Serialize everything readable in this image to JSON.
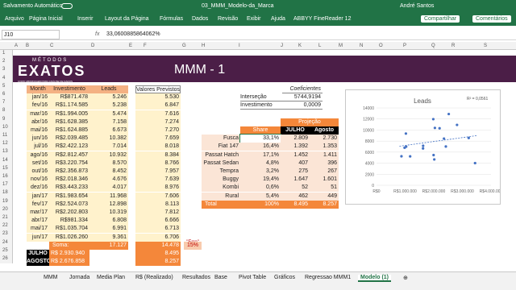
{
  "titlebar": {
    "autosave": "Salvamento Automático",
    "file": "03_MMM_Modelo-da_Marca",
    "user": "André Santos"
  },
  "ribbon": {
    "tabs": [
      "Arquivo",
      "Página Inicial",
      "Inserir",
      "Layout da Página",
      "Fórmulas",
      "Dados",
      "Revisão",
      "Exibir",
      "Ajuda",
      "ABBYY FineReader 12"
    ],
    "share": "Compartilhar",
    "comments": "Comentários"
  },
  "formula": {
    "namebox": "J10",
    "fx": "fx",
    "value": "33,0600885864062%"
  },
  "columns": [
    "A",
    "B",
    "C",
    "D",
    "E",
    "F",
    "G",
    "H",
    "I",
    "J",
    "K",
    "L",
    "M",
    "N",
    "O",
    "P",
    "Q",
    "R",
    "S"
  ],
  "rows": [
    "1",
    "2",
    "3",
    "4",
    "5",
    "6",
    "7",
    "8",
    "9",
    "10",
    "11",
    "12",
    "13",
    "14",
    "15",
    "16",
    "17",
    "18",
    "19",
    "20",
    "21",
    "22",
    "23",
    "24",
    "25",
    "26"
  ],
  "banner": {
    "logo_top": "MÉTODOS",
    "logo_main": "EXATOS",
    "logo_sub": "COMO ABORDAGEM PARA ANÁLISE DE DADOS",
    "title": "MMM - 1"
  },
  "main_table": {
    "headers": [
      "Month",
      "Investimento",
      "Leads"
    ],
    "rows": [
      [
        "jan/16",
        "R$871.478",
        "5.246"
      ],
      [
        "fev/16",
        "R$1.174.585",
        "5.238"
      ],
      [
        "mar/16",
        "R$1.994.005",
        "5.474"
      ],
      [
        "abr/16",
        "R$1.628.385",
        "7.158"
      ],
      [
        "mai/16",
        "R$1.624.885",
        "6.673"
      ],
      [
        "jun/16",
        "R$2.039.485",
        "10.382"
      ],
      [
        "jul/16",
        "R$2.422.123",
        "7.014"
      ],
      [
        "ago/16",
        "R$2.812.457",
        "10.932"
      ],
      [
        "set/16",
        "R$3.220.754",
        "8.570"
      ],
      [
        "out/16",
        "R$2.356.873",
        "8.452"
      ],
      [
        "nov/16",
        "R$2.018.346",
        "4.676"
      ],
      [
        "dez/16",
        "R$3.443.233",
        "4.017"
      ],
      [
        "jan/17",
        "R$1.983.654",
        "11.968"
      ],
      [
        "fev/17",
        "R$2.524.073",
        "12.898"
      ],
      [
        "mar/17",
        "R$2.202.803",
        "10.319"
      ],
      [
        "abr/17",
        "R$981.334",
        "6.808"
      ],
      [
        "mai/17",
        "R$1.035.704",
        "6.991"
      ],
      [
        "jun/17",
        "R$1.026.260",
        "9.361"
      ]
    ],
    "sum_label": "Soma:",
    "sum_value": "17.127"
  },
  "predicted": {
    "header": "Valores Previstos",
    "values": [
      "5.530",
      "6.847",
      "7.616",
      "7.274",
      "7.270",
      "7.659",
      "8.018",
      "8.384",
      "8.766",
      "7.957",
      "7.639",
      "8.976",
      "7.606",
      "8.113",
      "7.812",
      "6.666",
      "6.713",
      "6.706"
    ],
    "sum": "14.478",
    "erro_label": "\"Erro\"",
    "erro_value": "15%",
    "julho_pred": "8.495",
    "agosto_pred": "8.257"
  },
  "bottom": {
    "julho_label": "JULHO",
    "julho_value": "R$ 2.930.940",
    "agosto_label": "AGOSTO",
    "agosto_value": "R$ 2.676.858"
  },
  "coef": {
    "header": "Coeficientes",
    "rows": [
      [
        "Interseção",
        "5744,9194"
      ],
      [
        "Investimento",
        "0,0009"
      ]
    ]
  },
  "proj": {
    "header": "Projeção",
    "cols": [
      "Share",
      "JULHO",
      "Agosto"
    ],
    "rows": [
      [
        "Fusca",
        "33,1%",
        "2.809",
        "2.730"
      ],
      [
        "Fiat 147",
        "16,4%",
        "1.392",
        "1.353"
      ],
      [
        "Passat Hatch",
        "17,1%",
        "1.452",
        "1.411"
      ],
      [
        "Passat Sedan",
        "4,8%",
        "407",
        "396"
      ],
      [
        "Tempra",
        "3,2%",
        "275",
        "267"
      ],
      [
        "Buggy",
        "19,4%",
        "1.647",
        "1.601"
      ],
      [
        "Kombi",
        "0,6%",
        "52",
        "51"
      ],
      [
        "Rural",
        "5,4%",
        "462",
        "449"
      ]
    ],
    "total": [
      "Total",
      "100%",
      "8.495",
      "8.257"
    ]
  },
  "chart_data": {
    "type": "scatter",
    "title": "Leads",
    "annotation": "R² = 0,0561",
    "x": [
      871478,
      1174585,
      1994005,
      1628385,
      1624885,
      2039485,
      2422123,
      2812457,
      3220754,
      2356873,
      2018346,
      3443233,
      1983654,
      2524073,
      2202803,
      981334,
      1035704,
      1026260
    ],
    "y": [
      5246,
      5238,
      5474,
      7158,
      6673,
      10382,
      7014,
      10932,
      8570,
      8452,
      4676,
      4017,
      11968,
      12898,
      10319,
      6808,
      6991,
      9361
    ],
    "yticks": [
      "0",
      "2000",
      "4000",
      "6000",
      "8000",
      "10000",
      "12000",
      "14000"
    ],
    "xticks": [
      "R$0",
      "R$1.000.000",
      "R$2.000.000",
      "R$3.000.000",
      "R$4.000.000"
    ],
    "xlim": [
      0,
      4000000
    ],
    "ylim": [
      0,
      14000
    ],
    "trendline": true,
    "color": "#4472c4"
  },
  "sheets": [
    "MMM",
    "Jornada",
    "Media Plan",
    "R$ (Realizado)",
    "Resultados",
    "Base",
    "Pivot Table",
    "Gráficos",
    "Regressao MMM1",
    "Modelo (1)"
  ],
  "active_sheet": "Modelo (1)"
}
